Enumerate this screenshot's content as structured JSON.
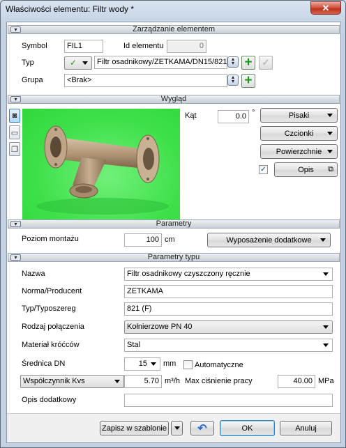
{
  "window": {
    "title": "Właściwości elementu: Filtr wody *",
    "close_glyph": "✕"
  },
  "sections": {
    "management": "Zarządzanie elementem",
    "appearance": "Wygląd",
    "parameters": "Parametry",
    "type_parameters": "Parametry typu"
  },
  "management": {
    "symbol_label": "Symbol",
    "symbol_value": "FIL1",
    "id_label": "Id elementu",
    "id_value": "0",
    "type_label": "Typ",
    "type_value": "Filtr osadnikowy/ZETKAMA/DN15/821",
    "group_label": "Grupa",
    "group_value": "<Brak>"
  },
  "appearance": {
    "angle_label": "Kąt",
    "angle_value": "0.0",
    "angle_unit": "°",
    "pens_button": "Pisaki",
    "fonts_button": "Czcionki",
    "surfaces_button": "Powierzchnie",
    "description_checked": true,
    "description_button": "Opis"
  },
  "parameters": {
    "mount_label": "Poziom montażu",
    "mount_value": "100",
    "mount_unit": "cm",
    "extra_button": "Wyposażenie dodatkowe"
  },
  "type_parameters": {
    "name_label": "Nazwa",
    "name_value": "Filtr osadnikowy czyszczony ręcznie",
    "producer_label": "Norma/Producent",
    "producer_value": "ZETKAMA",
    "series_label": "Typ/Typoszereg",
    "series_value": "821 (F)",
    "connection_label": "Rodzaj połączenia",
    "connection_value": "Kołnierzowe PN 40",
    "material_label": "Materiał króćców",
    "material_value": "Stal",
    "dn_label": "Średnica DN",
    "dn_value": "15",
    "dn_unit": "mm",
    "auto_label": "Automatyczne",
    "auto_checked": false,
    "kvs_select": "Współczynnik Kvs",
    "kvs_value": "5.70",
    "kvs_unit": "m³/h",
    "pressure_label": "Max ciśnienie pracy",
    "pressure_value": "40.00",
    "pressure_unit": "MPa",
    "notes_label": "Opis dodatkowy",
    "notes_value": ""
  },
  "footer": {
    "save_template": "Zapisz w szablonie",
    "undo_glyph": "↶",
    "ok": "OK",
    "cancel": "Anuluj"
  },
  "colors": {
    "preview_bg": "#3ee04a",
    "part_color": "#b59a7a",
    "accent": "#1a9a1a"
  }
}
